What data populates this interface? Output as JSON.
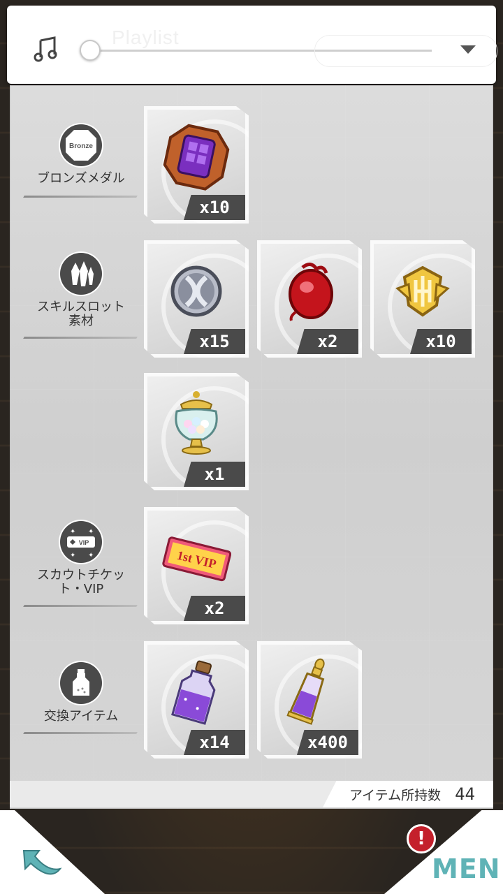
{
  "music": {
    "title": "Playlist",
    "volume_fraction": 0.0
  },
  "categories": [
    {
      "id": "bronze",
      "label": "ブロンズメダル",
      "icon": "bronze-medal-icon",
      "icon_text": "Bronze"
    },
    {
      "id": "skill",
      "label": "スキルスロット\n素材",
      "icon": "crystal-icon"
    },
    {
      "id": "vip",
      "label": "スカウトチケッ\nト・VIP",
      "icon": "vip-ticket-icon",
      "icon_text": "VIP"
    },
    {
      "id": "exchange",
      "label": "交換アイテム",
      "icon": "bottle-icon"
    }
  ],
  "items": [
    {
      "name": "bronze-medal",
      "qty": "x10",
      "icon": "bronze-medal-item-icon"
    },
    {
      "name": "silver-emblem",
      "qty": "x15",
      "icon": "silver-emblem-icon"
    },
    {
      "name": "red-gem",
      "qty": "x2",
      "icon": "red-gem-icon"
    },
    {
      "name": "gold-emblem",
      "qty": "x10",
      "icon": "gold-emblem-icon"
    },
    {
      "name": "candy-jar",
      "qty": "x1",
      "icon": "candy-jar-icon"
    },
    {
      "name": "vip-ticket",
      "qty": "x2",
      "icon": "vip-ticket-item-icon",
      "ticket_text": "1st VIP"
    },
    {
      "name": "purple-bottle",
      "qty": "x14",
      "icon": "purple-bottle-icon"
    },
    {
      "name": "perfume-bottle",
      "qty": "x400",
      "icon": "perfume-bottle-icon"
    }
  ],
  "footer": {
    "count_label": "アイテム所持数",
    "count_value": "44"
  },
  "nav": {
    "menu_label": "MENU",
    "alert": "!"
  },
  "colors": {
    "accent_teal": "#5fb3b6",
    "alert_red": "#c4202b",
    "dark_plate": "#4a4a4a"
  }
}
